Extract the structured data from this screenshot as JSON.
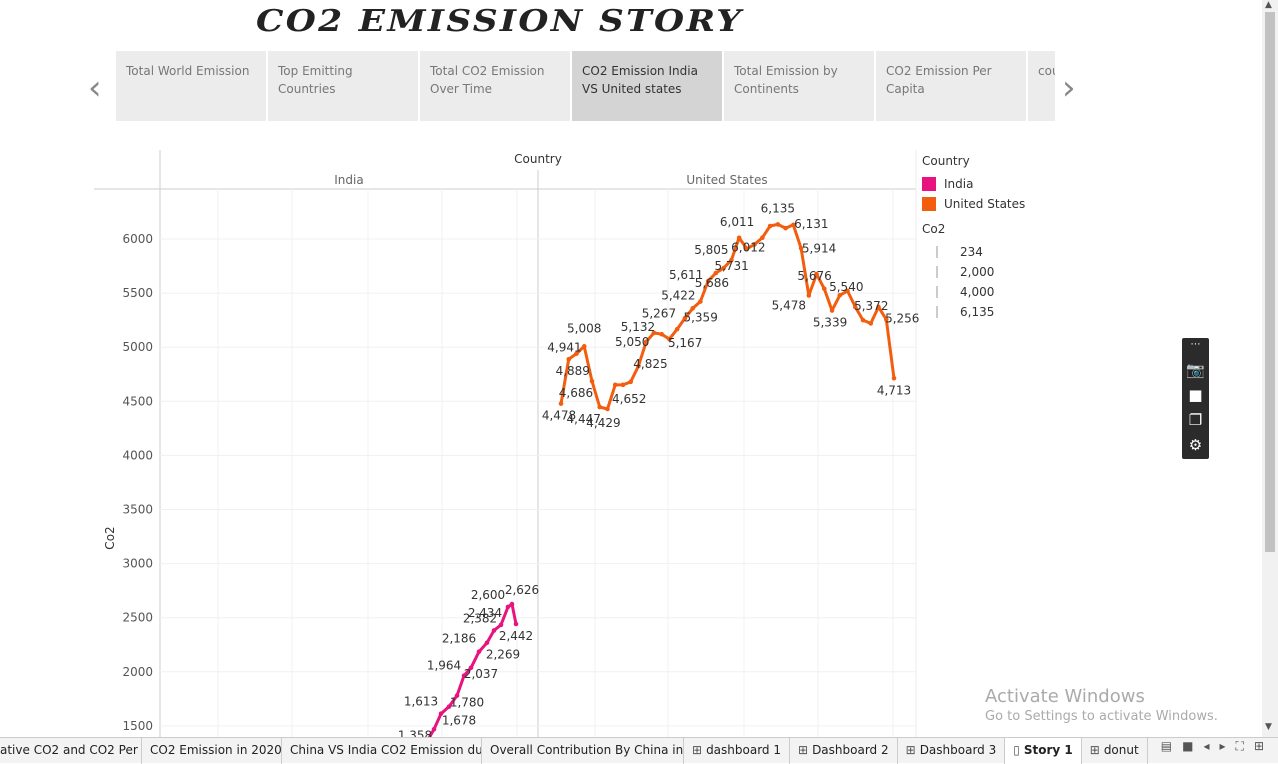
{
  "header": {
    "title": "CO2 EMISSION STORY"
  },
  "story": {
    "prev_icon": "chevron-left-icon",
    "next_icon": "chevron-right-icon",
    "points": [
      {
        "label": "Total World Emission"
      },
      {
        "label": "Top Emitting Countries"
      },
      {
        "label": "Total CO2 Emission Over Time"
      },
      {
        "label": "CO2 Emission India VS United states",
        "active": true
      },
      {
        "label": "Total Emission by Continents"
      },
      {
        "label": "CO2 Emission Per Capita"
      },
      {
        "label": "cou"
      }
    ]
  },
  "chart_data": {
    "type": "line",
    "column_header": "Country",
    "panels": [
      "India",
      "United States"
    ],
    "ylabel": "Co2",
    "y_ticks": [
      1500,
      2000,
      2500,
      3000,
      3500,
      4000,
      4500,
      5000,
      5500,
      6000
    ],
    "ylim": [
      1450,
      6500
    ],
    "grid": true,
    "series": [
      {
        "name": "India",
        "color": "#e8137e",
        "values": [
          1358,
          1469,
          1613,
          1678,
          1780,
          1964,
          2037,
          2186,
          2269,
          2382,
          2434,
          2600,
          2626,
          2442
        ],
        "labels": [
          "1,358",
          "",
          "1,613",
          "1,678",
          "1,780",
          "1,964",
          "2,037",
          "2,186",
          "2,269",
          "2,382",
          "2,434",
          "2,600",
          "2,626",
          "2,442"
        ]
      },
      {
        "name": "United States",
        "color": "#f25d0e",
        "values": [
          4478,
          4889,
          4941,
          5008,
          4686,
          4447,
          4429,
          4652,
          4652,
          4680,
          4825,
          5050,
          5132,
          5120,
          5075,
          5167,
          5267,
          5359,
          5422,
          5611,
          5686,
          5731,
          5805,
          6011,
          5910,
          5950,
          6012,
          6120,
          6135,
          6100,
          6131,
          5914,
          5478,
          5676,
          5540,
          5339,
          5480,
          5520,
          5372,
          5250,
          5220,
          5372,
          5256,
          4713
        ],
        "labels": [
          "4,478",
          "4,889",
          "4,941",
          "5,008",
          "4,686",
          "4,447",
          "4,429",
          "4,652",
          "",
          "",
          "4,825",
          "5,050",
          "5,132",
          "",
          "",
          "5,167",
          "5,267",
          "5,359",
          "5,422",
          "5,611",
          "5,686",
          "5,731",
          "5,805",
          "6,011",
          "",
          "",
          "6,012",
          "",
          "6,135",
          "",
          "6,131",
          "5,914",
          "5,478",
          "5,676",
          "5,540",
          "5,339",
          "",
          "",
          "5,372",
          "",
          "",
          "",
          "5,256",
          "4,713"
        ]
      }
    ],
    "legend": {
      "title": "Country",
      "entries": [
        {
          "label": "India",
          "color": "#e8137e"
        },
        {
          "label": "United States",
          "color": "#f25d0e"
        }
      ],
      "size_title": "Co2",
      "size_entries": [
        "234",
        "2,000",
        "4,000",
        "6,135"
      ],
      "placement": "right"
    }
  },
  "toolbox": {
    "icons": [
      "camera-icon",
      "video-icon",
      "window-icon",
      "gear-icon"
    ]
  },
  "watermark": {
    "line1": "Activate Windows",
    "line2": "Go to Settings to activate Windows."
  },
  "sheets": {
    "tabs": [
      {
        "label": "ative CO2 and CO2 Per ...",
        "icon": ""
      },
      {
        "label": "CO2 Emission in 2020",
        "icon": ""
      },
      {
        "label": "China VS India CO2 Emission du...",
        "icon": ""
      },
      {
        "label": "Overall Contribution By China in ...",
        "icon": ""
      },
      {
        "label": "dashboard 1",
        "icon": "⊞"
      },
      {
        "label": "Dashboard 2",
        "icon": "⊞"
      },
      {
        "label": "Dashboard 3",
        "icon": "⊞"
      },
      {
        "label": "Story 1",
        "icon": "📖",
        "active": true
      },
      {
        "label": "donut",
        "icon": "⊞"
      }
    ]
  }
}
